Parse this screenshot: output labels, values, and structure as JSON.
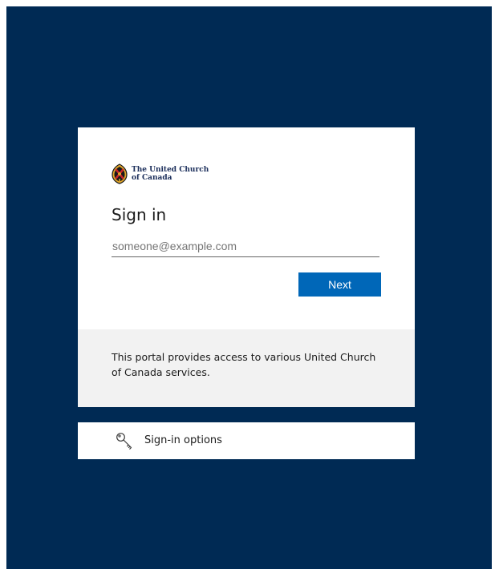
{
  "brand": {
    "name": "The United Church\nof Canada"
  },
  "signin": {
    "title": "Sign in",
    "email_placeholder": "someone@example.com",
    "email_value": "",
    "next_label": "Next"
  },
  "footer": {
    "text": "This portal provides access to various United Church of Canada services."
  },
  "options": {
    "label": "Sign-in options",
    "icon": "key-icon"
  },
  "colors": {
    "background": "#002a54",
    "primary_button": "#0067b8",
    "footer_bg": "#f2f2f2"
  }
}
